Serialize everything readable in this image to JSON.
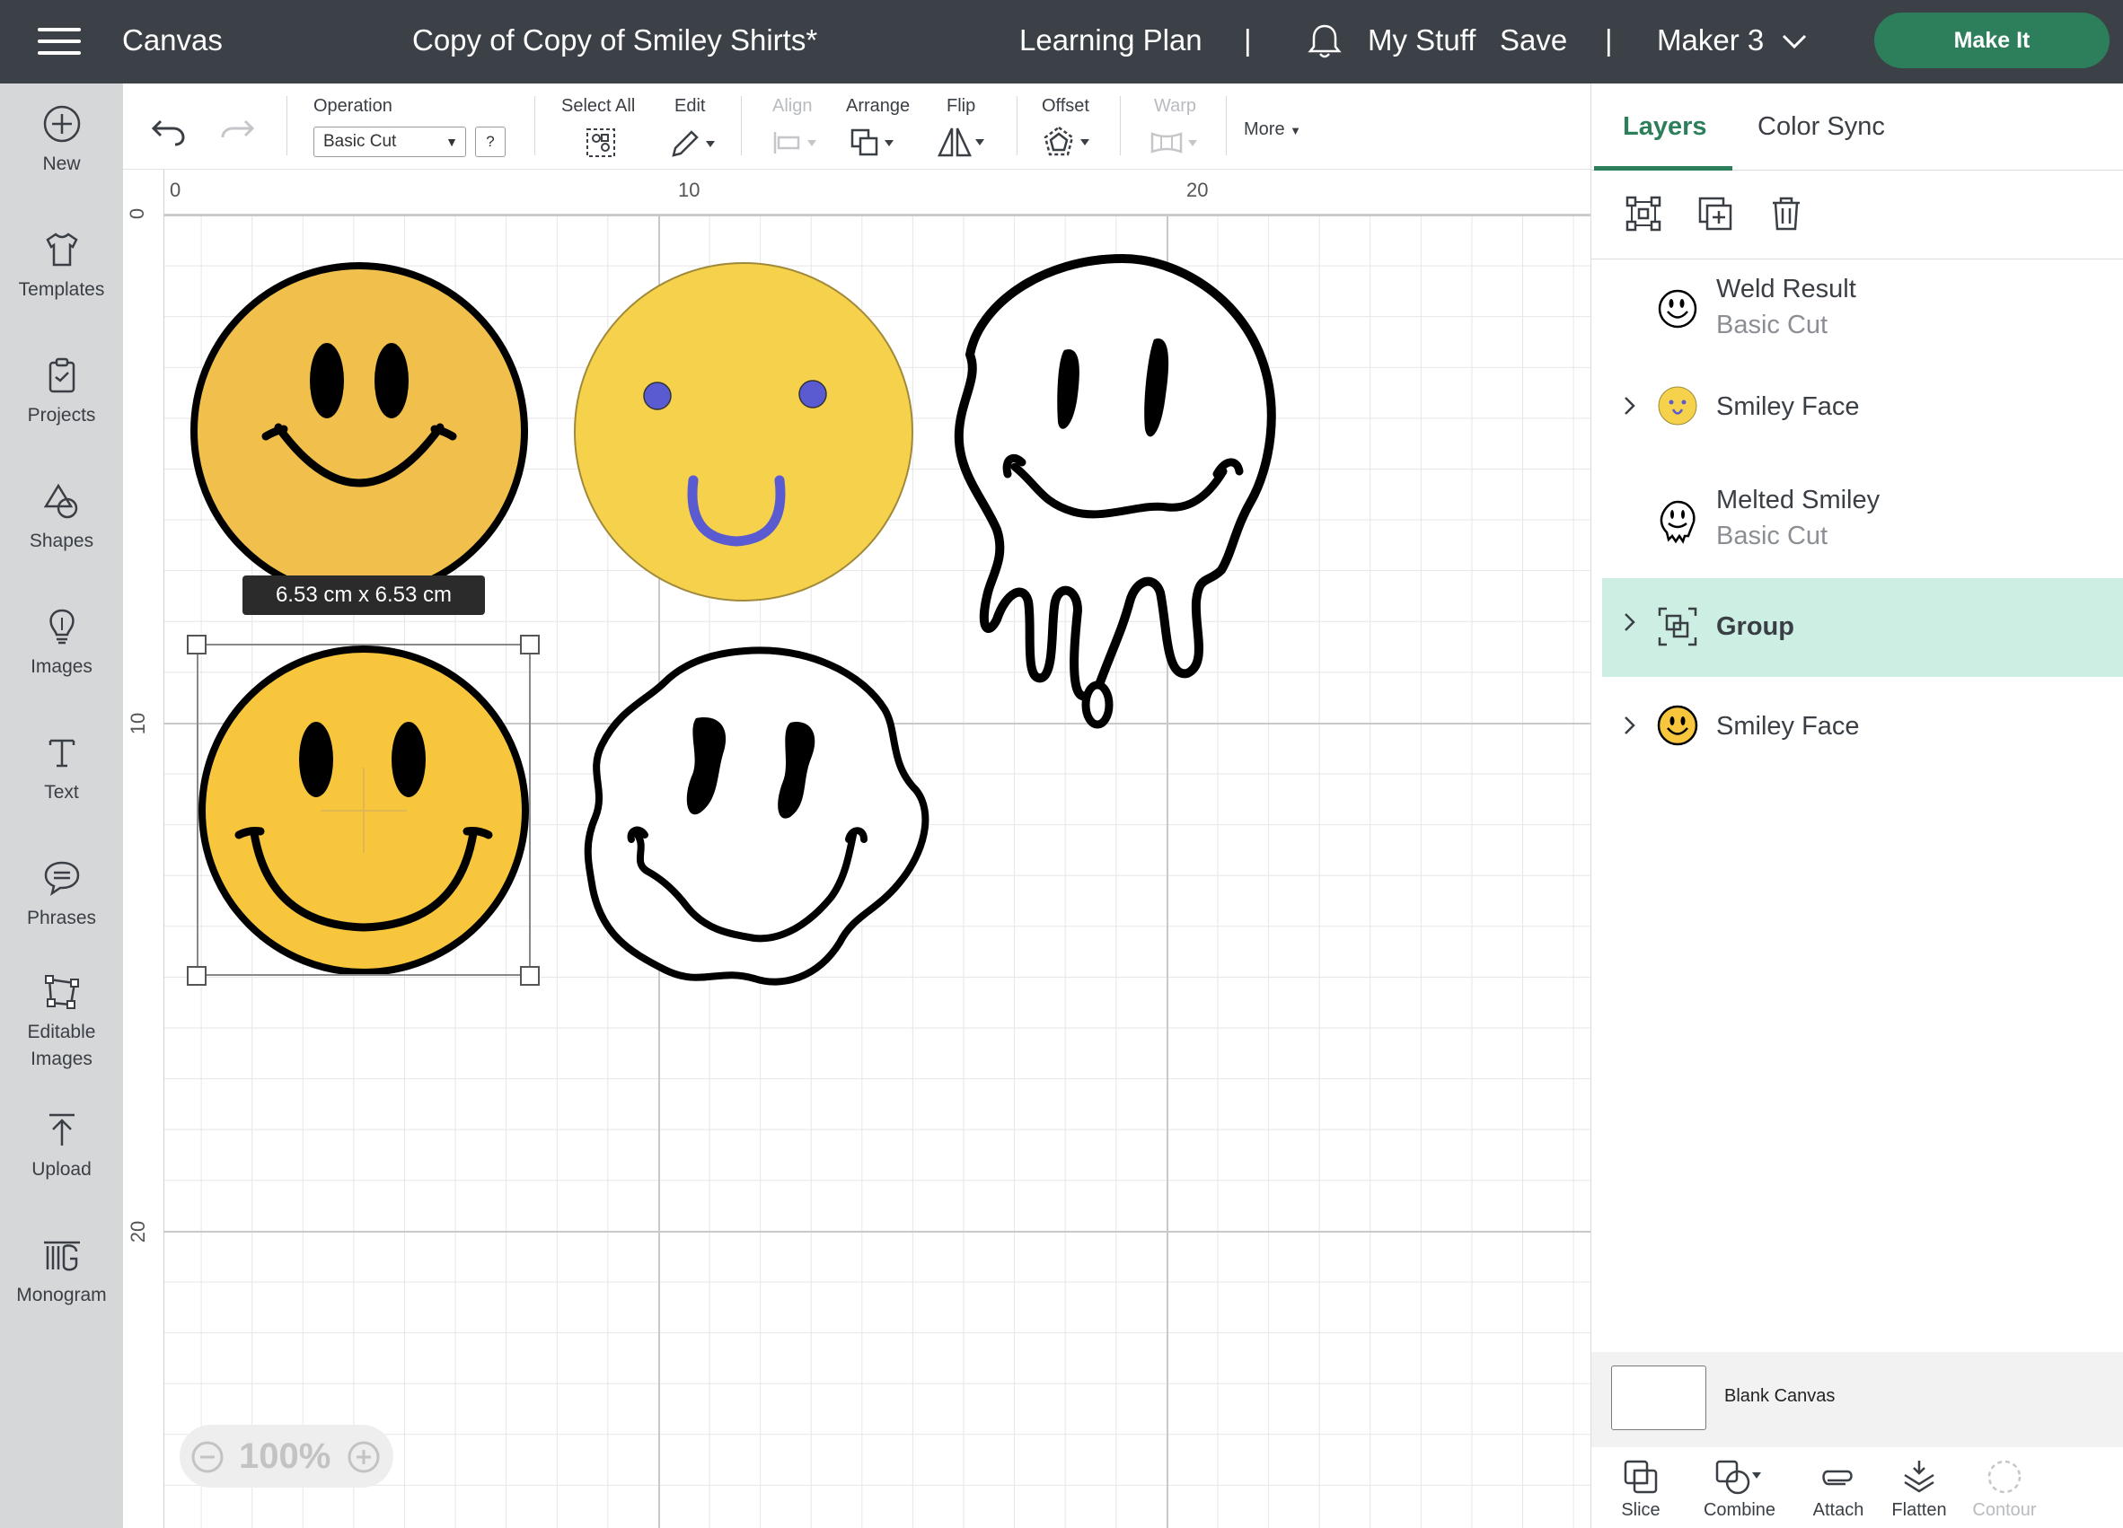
{
  "topbar": {
    "app_title": "Canvas",
    "project_title": "Copy of Copy of Smiley Shirts*",
    "learning_plan": "Learning Plan",
    "separator": "|",
    "my_stuff": "My Stuff",
    "save": "Save",
    "machine": "Maker 3",
    "make_it": "Make It"
  },
  "sidebar": {
    "items": [
      {
        "label": "New",
        "icon": "plus-circle-icon"
      },
      {
        "label": "Templates",
        "icon": "shirt-icon"
      },
      {
        "label": "Projects",
        "icon": "clipboard-icon"
      },
      {
        "label": "Shapes",
        "icon": "shapes-icon"
      },
      {
        "label": "Images",
        "icon": "lightbulb-icon"
      },
      {
        "label": "Text",
        "icon": "text-icon"
      },
      {
        "label": "Phrases",
        "icon": "speech-bubble-icon"
      },
      {
        "label": "Editable",
        "label2": "Images",
        "icon": "editable-images-icon"
      },
      {
        "label": "Upload",
        "icon": "upload-icon"
      },
      {
        "label": "Monogram",
        "icon": "monogram-icon"
      }
    ]
  },
  "toolbar": {
    "operation_label": "Operation",
    "operation_value": "Basic Cut",
    "help": "?",
    "select_all": "Select All",
    "edit": "Edit",
    "align": "Align",
    "arrange": "Arrange",
    "flip": "Flip",
    "offset": "Offset",
    "warp": "Warp",
    "more": "More"
  },
  "rulers": {
    "top": [
      "0",
      "10",
      "20"
    ],
    "left": [
      "0",
      "10",
      "20"
    ]
  },
  "canvas": {
    "size_tooltip": "6.53  cm x 6.53  cm",
    "zoom": "100%",
    "colors": {
      "smiley_orange": "#f0bf4c",
      "smiley_yellow": "#f6d24c",
      "smiley_gold": "#f7c63d",
      "eye_purple": "#5a5bd0"
    }
  },
  "panel": {
    "tabs": [
      "Layers",
      "Color Sync"
    ],
    "layers": [
      {
        "name": "Weld Result",
        "sub": "Basic Cut",
        "icon": "smiley-outline-icon"
      },
      {
        "name": "Smiley Face",
        "icon": "smiley-yellow-icon"
      },
      {
        "name": "Melted Smiley",
        "sub": "Basic Cut",
        "icon": "melted-smiley-icon"
      },
      {
        "name": "Group",
        "icon": "group-icon",
        "selected": true
      },
      {
        "name": "Smiley Face",
        "icon": "smiley-gold-icon"
      }
    ],
    "blank_canvas": "Blank Canvas",
    "bottom_tools": [
      "Slice",
      "Combine",
      "Attach",
      "Flatten",
      "Contour"
    ],
    "accent": "#2d7f5b",
    "selected_bg": "#cdeee2"
  }
}
